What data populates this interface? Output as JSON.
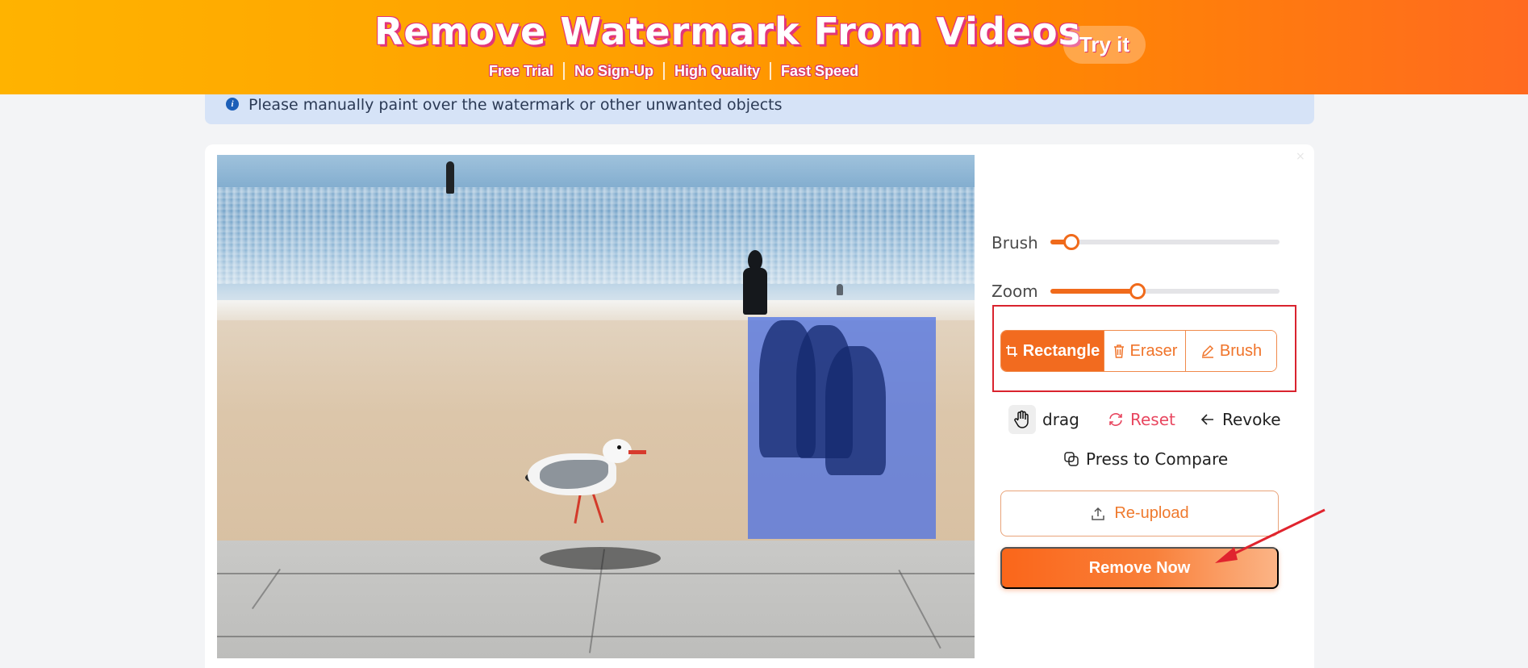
{
  "banner": {
    "title": "Remove Watermark From Videos",
    "features": [
      "Free Trial",
      "No Sign-Up",
      "High Quality",
      "Fast Speed"
    ],
    "try_label": "Try it"
  },
  "info": {
    "icon": "info-icon",
    "text": "Please manually paint over the watermark or other unwanted objects"
  },
  "editor": {
    "image": "beach-seagull-photo",
    "brush": {
      "label": "Brush",
      "value_fraction": 0.09
    },
    "zoom": {
      "label": "Zoom",
      "value_fraction": 0.38
    },
    "tools": [
      {
        "label": "Rectangle",
        "icon": "crop-icon",
        "active": true
      },
      {
        "label": "Eraser",
        "icon": "trash-icon",
        "active": false
      },
      {
        "label": "Brush",
        "icon": "pencil-icon",
        "active": false
      }
    ],
    "actions": {
      "drag": "drag",
      "reset": "Reset",
      "revoke": "Revoke",
      "compare": "Press to Compare"
    },
    "reupload_label": "Re-upload",
    "remove_label": "Remove Now"
  },
  "colors": {
    "accent": "#f26b1f",
    "highlight_border": "#d9232e",
    "reset": "#e8465f",
    "selection": "#466ee6"
  }
}
